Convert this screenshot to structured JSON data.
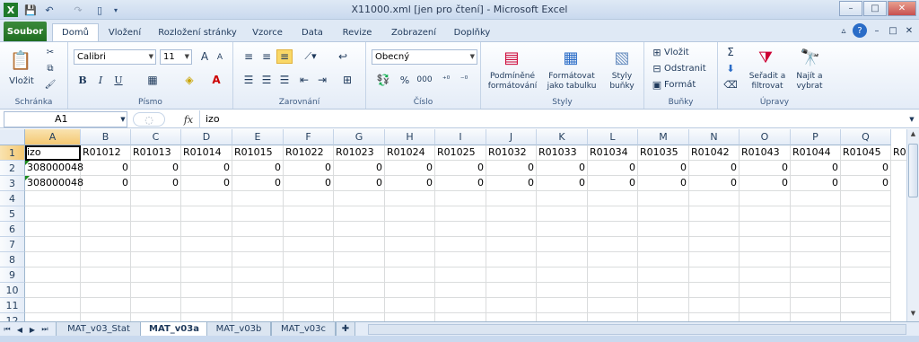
{
  "titlebar": {
    "title": "X11000.xml  [jen pro čtení]  -  Microsoft Excel",
    "app_icon": "X",
    "qat": [
      "save-icon",
      "undo-icon",
      "redo-icon",
      "new-icon",
      "customize-icon"
    ],
    "min": "–",
    "max": "□",
    "close": "✕",
    "rib_min": "–",
    "rib_max": "□",
    "rib_close": "✕"
  },
  "tabs": [
    "Soubor",
    "Domů",
    "Vložení",
    "Rozložení stránky",
    "Vzorce",
    "Data",
    "Revize",
    "Zobrazení",
    "Doplňky"
  ],
  "ribbon": {
    "clipboard": {
      "paste": "Vložit",
      "label": "Schránka"
    },
    "font": {
      "name": "Calibri",
      "size": "11",
      "grow": "A",
      "shrink": "A",
      "bold": "B",
      "italic": "I",
      "underline": "U",
      "label": "Písmo"
    },
    "alignment": {
      "label": "Zarovnání"
    },
    "number": {
      "format": "Obecný",
      "percent": "%",
      "thousands": "000",
      "label": "Číslo"
    },
    "styles": {
      "conditional": "Podmíněné\nformátování",
      "as_table": "Formátovat\njako tabulku",
      "cell_styles": "Styly\nbuňky",
      "label": "Styly"
    },
    "cells": {
      "insert": "Vložit",
      "delete": "Odstranit",
      "format": "Formát",
      "label": "Buňky"
    },
    "editing": {
      "sum": "Σ",
      "sort": "Seřadit a\nfiltrovat",
      "find": "Najít a\nvybrat",
      "label": "Úpravy"
    }
  },
  "formula": {
    "namebox": "A1",
    "fx": "fx",
    "value": "izo"
  },
  "grid": {
    "columns": [
      "A",
      "B",
      "C",
      "D",
      "E",
      "F",
      "G",
      "H",
      "I",
      "J",
      "K",
      "L",
      "M",
      "N",
      "O",
      "P",
      "Q"
    ],
    "rows": [
      "1",
      "2",
      "3",
      "4",
      "5",
      "6",
      "7",
      "8",
      "9",
      "10",
      "11",
      "12"
    ],
    "header_row": [
      "izo",
      "R01012",
      "R01013",
      "R01014",
      "R01015",
      "R01022",
      "R01023",
      "R01024",
      "R01025",
      "R01032",
      "R01033",
      "R01034",
      "R01035",
      "R01042",
      "R01043",
      "R01044",
      "R01045",
      "R01"
    ],
    "data_rows": [
      [
        "308000048",
        "0",
        "0",
        "0",
        "0",
        "0",
        "0",
        "0",
        "0",
        "0",
        "0",
        "0",
        "0",
        "0",
        "0",
        "0",
        "0"
      ],
      [
        "308000048",
        "0",
        "0",
        "0",
        "0",
        "0",
        "0",
        "0",
        "0",
        "0",
        "0",
        "0",
        "0",
        "0",
        "0",
        "0",
        "0"
      ]
    ]
  },
  "sheets": [
    "MAT_v03_Stat",
    "MAT_v03a",
    "MAT_v03b",
    "MAT_v03c"
  ],
  "active_sheet": "MAT_v03a",
  "colors": {
    "file_tab": "#2a7a2c",
    "accent": "#1e395b"
  }
}
